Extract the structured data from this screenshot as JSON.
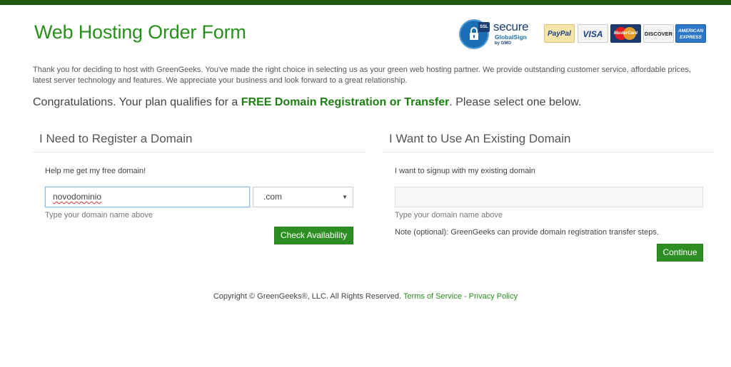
{
  "header": {
    "title": "Web Hosting Order Form"
  },
  "badges": {
    "ssl_label": "SSL",
    "secure_label": "secure",
    "globalsign_label": "GlobalSign",
    "gmo_label": "by GMO",
    "cards": {
      "paypal": "PayPal",
      "visa": "VISA",
      "mastercard": "MasterCard",
      "discover": "DISCOVER",
      "amex_line1": "AMERICAN",
      "amex_line2": "EXPRESS"
    }
  },
  "intro": "Thank you for deciding to host with GreenGeeks. You've made the right choice in selecting us as your green web hosting partner. We provide outstanding customer service, affordable prices, latest server technology and features. We appreciate your business and look forward to a great relationship.",
  "congrats": {
    "before": "Congratulations. Your plan qualifies for a ",
    "highlight": "FREE Domain Registration or Transfer",
    "after": ". Please select one below."
  },
  "register": {
    "heading": "I Need to Register a Domain",
    "label": "Help me get my free domain!",
    "domain_value": "novodominio",
    "tld_selected": ".com",
    "hint": "Type your domain name above",
    "button": "Check Availability"
  },
  "existing": {
    "heading": "I Want to Use An Existing Domain",
    "label": "I want to signup with my existing domain",
    "domain_value": "",
    "hint": "Type your domain name above",
    "note": "Note (optional): GreenGeeks can provide domain registration transfer steps.",
    "button": "Continue"
  },
  "footer": {
    "copyright": "Copyright © GreenGeeks®, LLC. All Rights Reserved.",
    "tos": "Terms of Service",
    "separator": "-",
    "privacy": "Privacy Policy"
  },
  "colors": {
    "brand_green": "#27901a",
    "button_green": "#2d8f23",
    "top_bar": "#1f5a10",
    "link_green": "#2a8a1e"
  }
}
